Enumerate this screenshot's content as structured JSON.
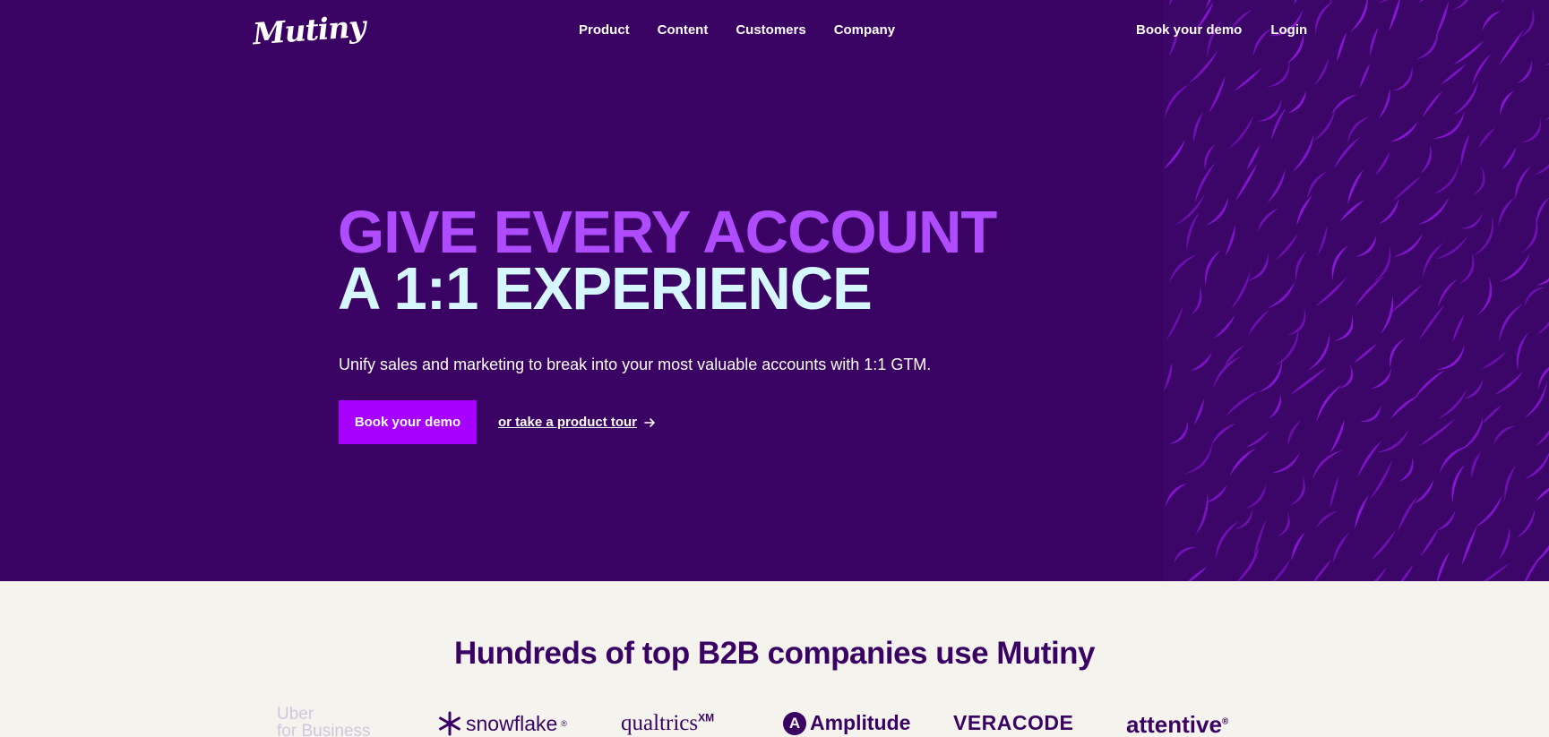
{
  "brand": {
    "logo_text": "Mutiny"
  },
  "nav": {
    "items": [
      {
        "label": "Product"
      },
      {
        "label": "Content"
      },
      {
        "label": "Customers"
      },
      {
        "label": "Company"
      }
    ],
    "right": [
      {
        "label": "Book your demo"
      },
      {
        "label": "Login"
      }
    ]
  },
  "hero": {
    "headline_line1": "GIVE EVERY ACCOUNT",
    "headline_line2": "A 1:1 EXPERIENCE",
    "subtitle": "Unify sales and marketing to break into your most valuable accounts with 1:1 GTM.",
    "cta_label": "Book your demo",
    "tour_label": "or take a product tour",
    "tour_icon": "arrow-right-icon"
  },
  "customers": {
    "title": "Hundreds of top B2B companies use Mutiny",
    "logos": [
      {
        "name": "Uber for Business",
        "line1": "Uber",
        "line2": "for Business"
      },
      {
        "name": "snowflake",
        "text": "snowflake",
        "mark": "®"
      },
      {
        "name": "qualtrics",
        "text": "qualtrics",
        "sup": "XM"
      },
      {
        "name": "Amplitude",
        "text": "Amplitude",
        "icon": "A"
      },
      {
        "name": "VERACODE",
        "text": "VERACODE"
      },
      {
        "name": "attentive",
        "text": "attentive",
        "mark": "®"
      }
    ]
  },
  "colors": {
    "hero_bg": "#3a0363",
    "headline_accent": "#b04cff",
    "headline_light": "#d6f7ff",
    "cta_bg": "#a800ff",
    "page_bg": "#f4f3ee",
    "pattern_stroke": "#8a17d8"
  }
}
